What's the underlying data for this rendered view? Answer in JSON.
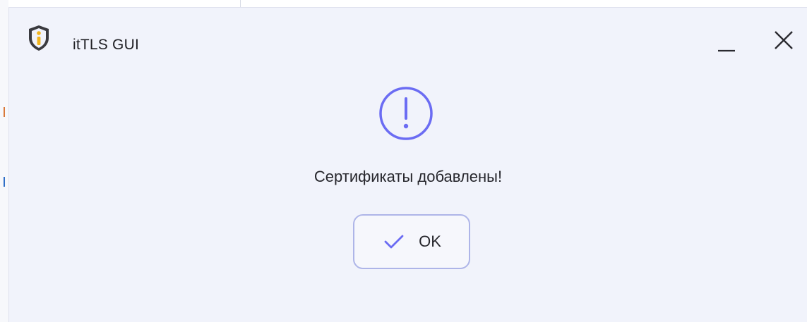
{
  "window": {
    "title": "itTLS GUI"
  },
  "dialog": {
    "icon": "exclamation-circle-icon",
    "message": "Сертификаты добавлены!",
    "ok_button": {
      "label": "OK",
      "icon": "check-icon"
    }
  },
  "colors": {
    "accent": "#6b6cf3",
    "dialog_background": "#f1f3fb",
    "logo_dark": "#3a3a3f",
    "logo_yellow": "#f2b51d"
  }
}
